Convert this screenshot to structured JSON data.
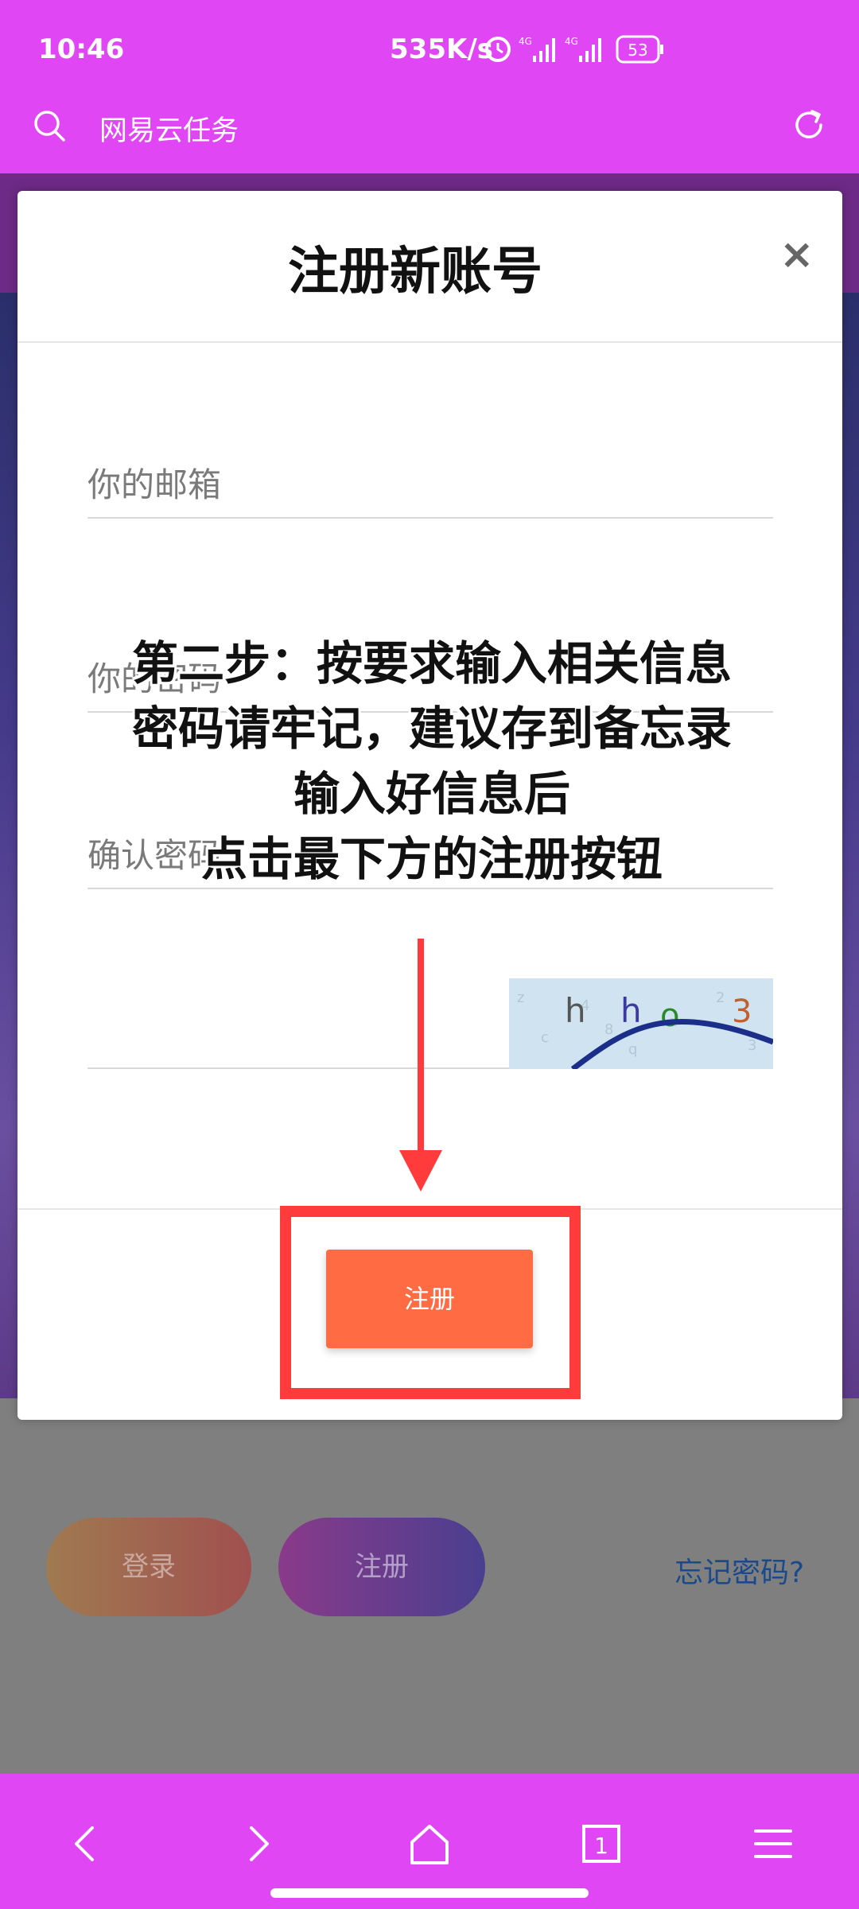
{
  "status_bar": {
    "time": "10:46",
    "network_speed": "535K/s",
    "signal_1": "4G",
    "signal_2": "4G",
    "battery": "53"
  },
  "browser": {
    "address_text": "网易云任务"
  },
  "background_page": {
    "login_label": "登录",
    "register_label": "注册",
    "forgot_label": "忘记密码?"
  },
  "modal": {
    "title": "注册新账号",
    "close_label": "×",
    "email_placeholder": "你的邮箱",
    "password_placeholder": "你的密码",
    "confirm_placeholder": "确认密码",
    "submit_label": "注册"
  },
  "annotation": {
    "line1": "第二步：按要求输入相关信息",
    "line2": "密码请牢记，建议存到备忘录",
    "line3": "输入好信息后",
    "line4": "点击最下方的注册按钮"
  },
  "colors": {
    "accent": "#e146f5",
    "submit": "#ff6b43",
    "highlight": "#ff3b3b"
  }
}
